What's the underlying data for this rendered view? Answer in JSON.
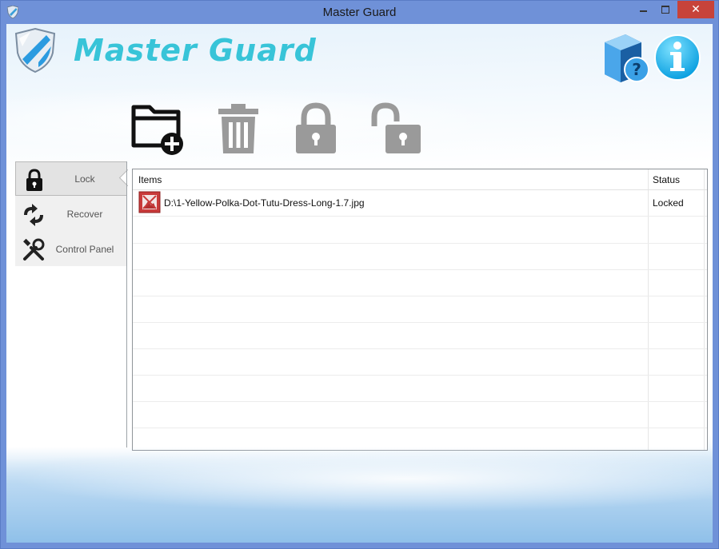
{
  "window": {
    "title": "Master Guard",
    "close_glyph": "✕"
  },
  "header": {
    "app_title": "Master Guard",
    "logo_icon": "shield-icon",
    "help_icon": "help-book-icon",
    "info_icon": "info-icon"
  },
  "toolbar": [
    {
      "name": "add-folder",
      "icon": "folder-add-icon",
      "enabled": true
    },
    {
      "name": "delete",
      "icon": "trash-icon",
      "enabled": false
    },
    {
      "name": "lock",
      "icon": "lock-icon",
      "enabled": false
    },
    {
      "name": "unlock",
      "icon": "unlock-icon",
      "enabled": false
    }
  ],
  "sidebar": {
    "items": [
      {
        "label": "Lock",
        "icon": "lock-icon",
        "selected": true
      },
      {
        "label": "Recover",
        "icon": "recover-arrows-icon",
        "selected": false
      },
      {
        "label": "Control Panel",
        "icon": "tools-icon",
        "selected": false
      }
    ]
  },
  "table": {
    "columns": [
      "Items",
      "Status"
    ],
    "rows": [
      {
        "item": "D:\\1-Yellow-Polka-Dot-Tutu-Dress-Long-1.7.jpg",
        "status": "Locked",
        "icon": "image-file-icon"
      }
    ]
  },
  "colors": {
    "title_bar": "#6f91d8",
    "brand_text": "#38c4d8",
    "close_button": "#c7433a",
    "icon_disabled": "#9a9a9a"
  }
}
